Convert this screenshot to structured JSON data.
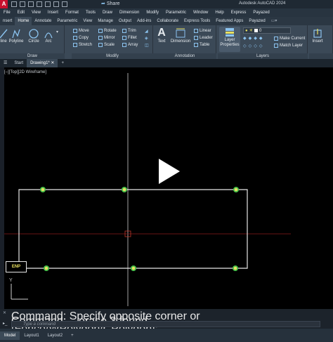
{
  "title_bar": {
    "app_logo": "A",
    "share": "Share",
    "app_title": "Autodesk AutoCAD 2024"
  },
  "menu": [
    "File",
    "Edit",
    "View",
    "Insert",
    "Format",
    "Tools",
    "Draw",
    "Dimension",
    "Modify",
    "Parametric",
    "Window",
    "Help",
    "Express",
    "Payazed"
  ],
  "ribbon_tabs": [
    "nsert",
    "Home",
    "Annotate",
    "Parametric",
    "View",
    "Manage",
    "Output",
    "Add-ins",
    "Collaborate",
    "Express Tools",
    "Featured Apps",
    "Payazed"
  ],
  "ribbon_active_tab": "Home",
  "draw_tools": [
    "line",
    "Polyline",
    "Circle",
    "Arc"
  ],
  "modify_tools": {
    "col1": [
      "Move",
      "Copy",
      "Stretch"
    ],
    "col2": [
      "Rotate",
      "Mirror",
      "Scale"
    ],
    "col3": [
      "Trim",
      "Fillet",
      "Array"
    ]
  },
  "annotation_tools": {
    "text": "Text",
    "dimension": "Dimension",
    "small": [
      "Linear",
      "Leader",
      "Table"
    ]
  },
  "layer_tools": {
    "layer_properties": "Layer Properties",
    "current_layer": "0",
    "make_current": "Make Current",
    "match_layer": "Match Layer"
  },
  "insert_tool": "Insert",
  "panel_labels": {
    "draw": "Draw",
    "modify": "Modify",
    "annotation": "Annotation",
    "layers": "Layers"
  },
  "file_tabs": [
    "Start",
    "Drawing1*"
  ],
  "file_tab_add": "+",
  "viewport_label": "[–][Top][2D Wireframe]",
  "ucs": {
    "y_label": "Y"
  },
  "tag_text": "ENP",
  "command": {
    "line1": "Command: Specify opposite corner or [Fence/WPolygon/CPolygon]:",
    "line2": "Command: _.erase 3 found",
    "placeholder": "Type a command"
  },
  "status_tabs": [
    "Model",
    "Layout1",
    "Layout2"
  ],
  "status_add": "+",
  "colors": {
    "accent": "#6fb0e8",
    "grip": "#e8e060",
    "grip_ring": "#46c24a",
    "crosshair_red": "#8b1a1a"
  }
}
